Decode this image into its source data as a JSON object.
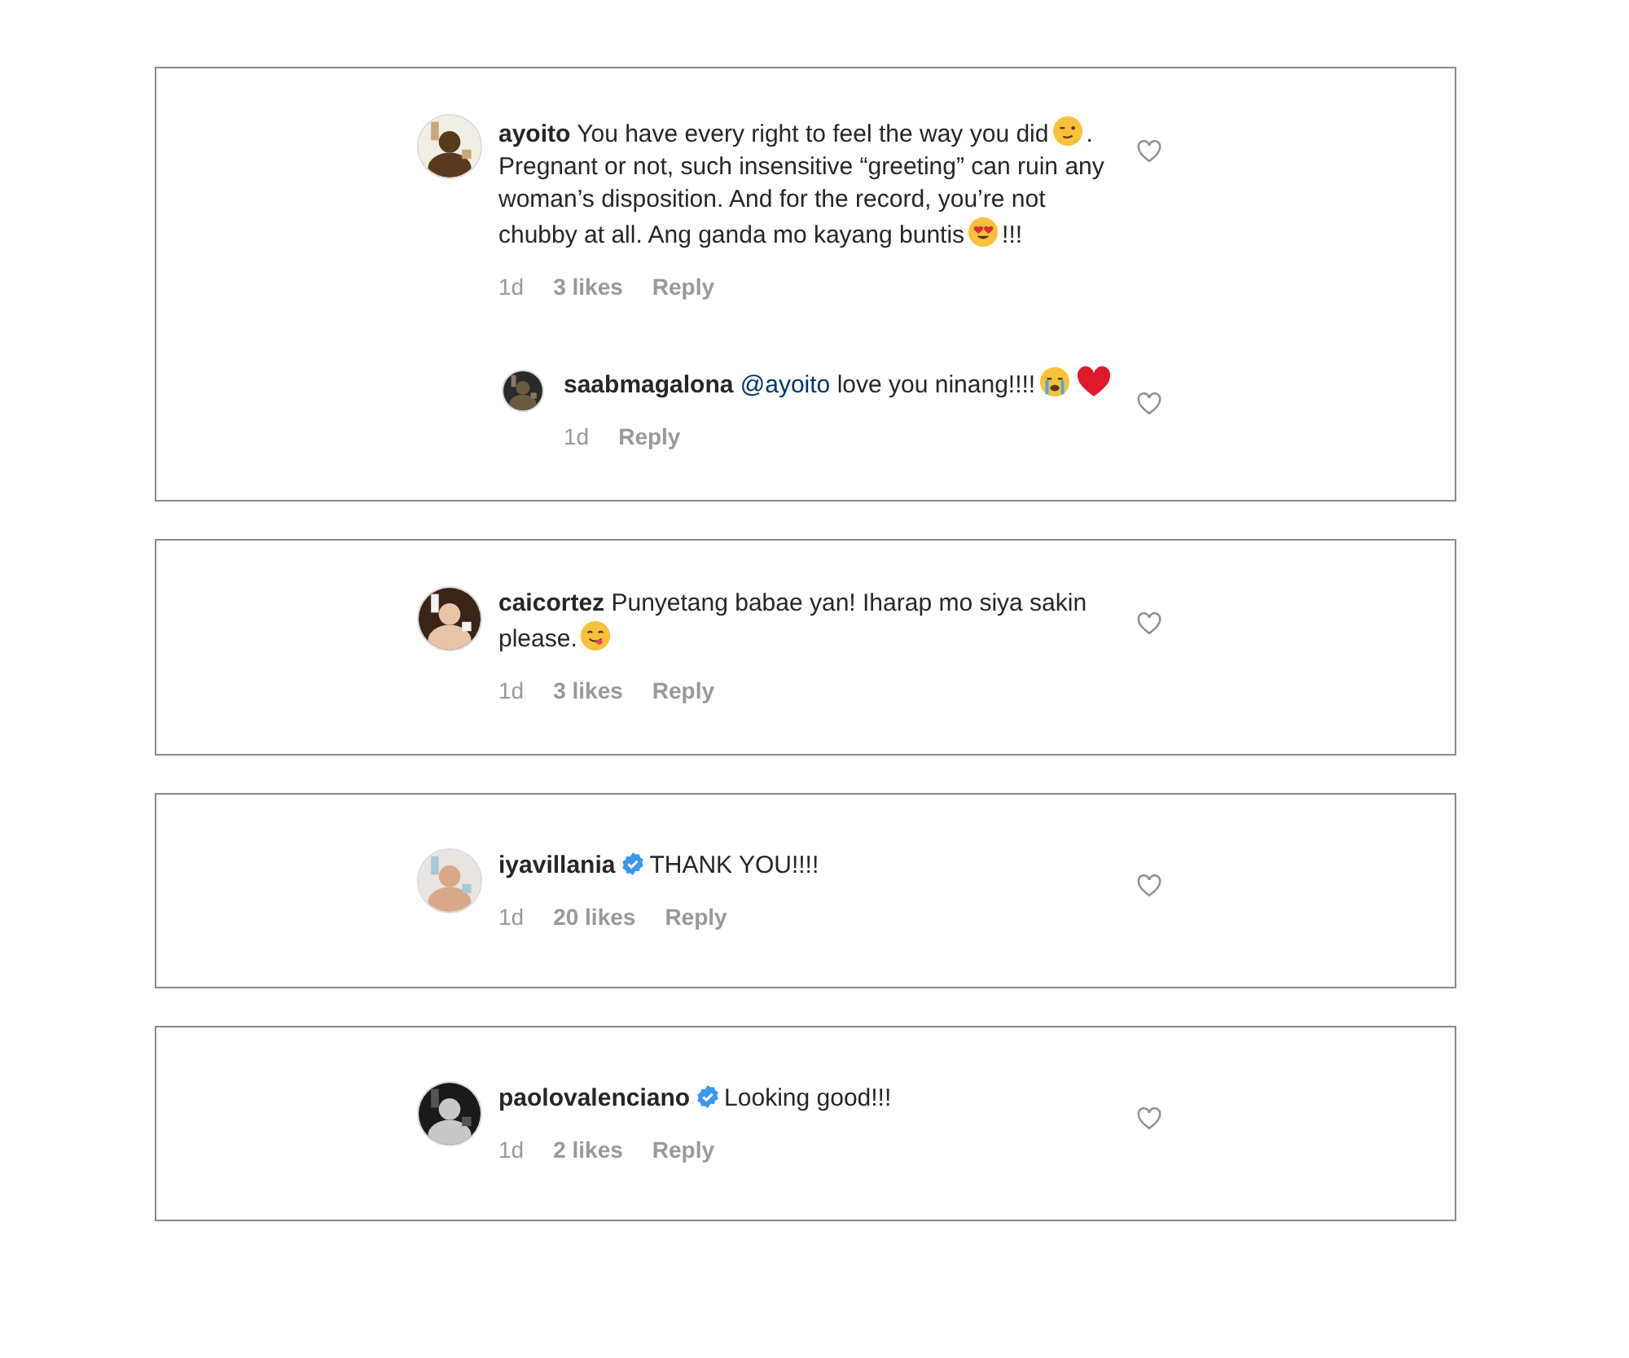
{
  "threads": [
    {
      "comment": {
        "username": "ayoito",
        "verified": false,
        "parts": [
          {
            "kind": "text",
            "text": "You have every right to feel the way you did"
          },
          {
            "kind": "wink"
          },
          {
            "kind": "text",
            "text": ". Pregnant or not, such insensitive “greeting” can ruin any woman’s disposition. And for the record, you’re not chubby at all. Ang ganda mo kayang buntis"
          },
          {
            "kind": "hearteyes"
          },
          {
            "kind": "text",
            "text": "!!!"
          }
        ],
        "time": "1d",
        "likes": "3 likes",
        "reply": "Reply"
      },
      "replies": [
        {
          "username": "saabmagalona",
          "verified": false,
          "parts": [
            {
              "kind": "mention",
              "text": "@ayoito"
            },
            {
              "kind": "text",
              "text": "love you ninang!!!!"
            },
            {
              "kind": "sob"
            },
            {
              "kind": "heart"
            }
          ],
          "time": "1d",
          "reply": "Reply"
        }
      ]
    },
    {
      "comment": {
        "username": "caicortez",
        "verified": false,
        "parts": [
          {
            "kind": "text",
            "text": "Punyetang babae yan! Iharap mo siya sakin please."
          },
          {
            "kind": "yum"
          }
        ],
        "time": "1d",
        "likes": "3 likes",
        "reply": "Reply"
      }
    },
    {
      "comment": {
        "username": "iyavillania",
        "verified": true,
        "parts": [
          {
            "kind": "text",
            "text": "THANK YOU!!!!"
          }
        ],
        "time": "1d",
        "likes": "20 likes",
        "reply": "Reply"
      }
    },
    {
      "comment": {
        "username": "paolovalenciano",
        "verified": true,
        "parts": [
          {
            "kind": "text",
            "text": "Looking good!!!"
          }
        ],
        "time": "1d",
        "likes": "2 likes",
        "reply": "Reply"
      }
    }
  ]
}
